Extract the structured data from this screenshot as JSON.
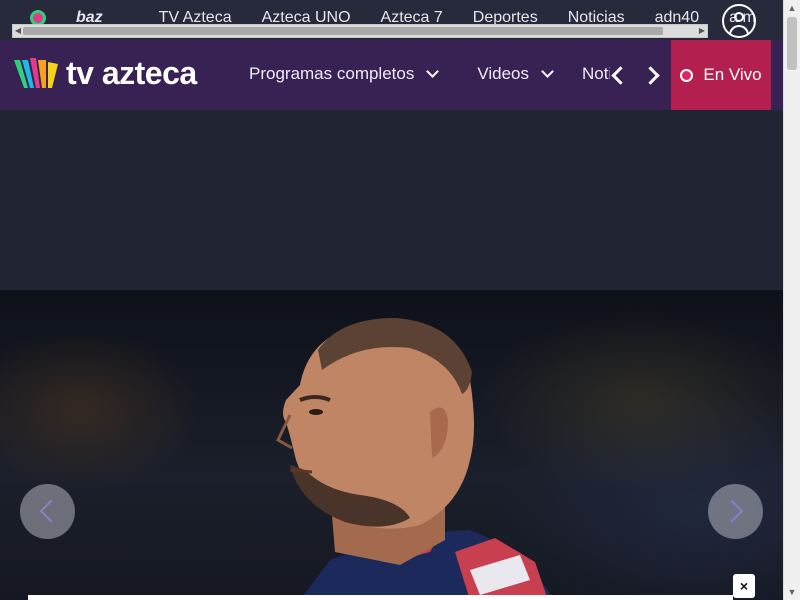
{
  "topbar": {
    "baz_label": "baz",
    "links": [
      "TV Azteca",
      "Azteca UNO",
      "Azteca 7",
      "Deportes",
      "Noticias",
      "adn40",
      "a m"
    ]
  },
  "header": {
    "logo_text": "tv azteca",
    "nav_items": [
      {
        "label": "Programas completos",
        "has_dropdown": true
      },
      {
        "label": "Videos",
        "has_dropdown": true
      }
    ],
    "nav_overflow_label": "Noticias",
    "live_label": "En Vivo"
  },
  "hero": {
    "close_label": "×"
  },
  "colors": {
    "top_strip": "#272a3a",
    "nav_bg": "#382153",
    "live_bg": "#b3204f",
    "page_bg": "#1f2230",
    "baz_green": "#2fd07a"
  }
}
